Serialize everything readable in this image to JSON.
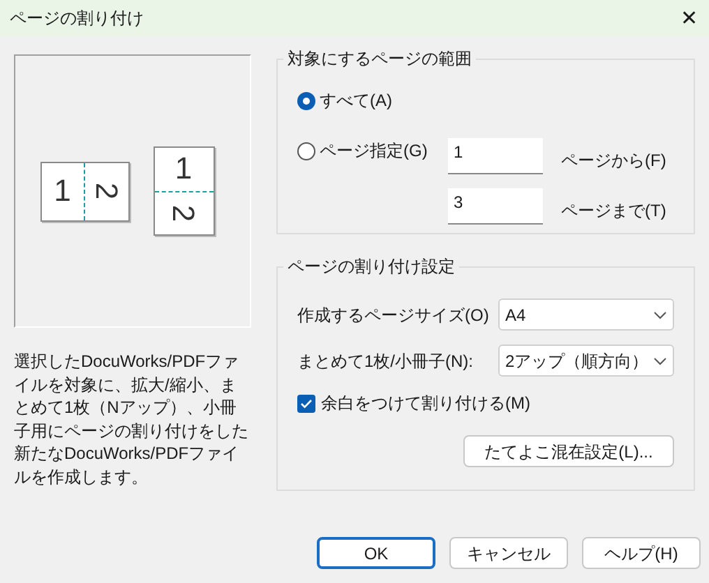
{
  "window": {
    "title": "ページの割り付け",
    "close": "✕"
  },
  "preview": {
    "pages": [
      {
        "kind": "side",
        "numbers": [
          "1",
          "2"
        ]
      },
      {
        "kind": "stack",
        "numbers": [
          "1",
          "2"
        ]
      }
    ]
  },
  "description": "選択したDocuWorks/PDFファイルを対象に、拡大/縮小、まとめて1枚（Nアップ）、小冊子用にページの割り付けをした新たなDocuWorks/PDFファイルを作成します。",
  "range_group": {
    "title": "対象にするページの範囲",
    "options": [
      {
        "label": "すべて(A)",
        "selected": true
      },
      {
        "label": "ページ指定(G)",
        "selected": false
      }
    ],
    "fields": [
      {
        "value": "1",
        "label": "ページから(F)"
      },
      {
        "value": "3",
        "label": "ページまで(T)"
      }
    ]
  },
  "layout_group": {
    "title": "ページの割り付け設定",
    "selects": [
      {
        "label": "作成するページサイズ(O)",
        "value": "A4"
      },
      {
        "label": "まとめて1枚/小冊子(N):",
        "value": "2アップ（順方向）"
      }
    ],
    "checkbox": {
      "label": "余白をつけて割り付ける(M)",
      "checked": true
    },
    "button": "たてよこ混在設定(L)..."
  },
  "buttons": [
    {
      "label": "OK",
      "kind": "default"
    },
    {
      "label": "キャンセル",
      "kind": "normal"
    },
    {
      "label": "ヘルプ(H)",
      "kind": "normal"
    }
  ]
}
